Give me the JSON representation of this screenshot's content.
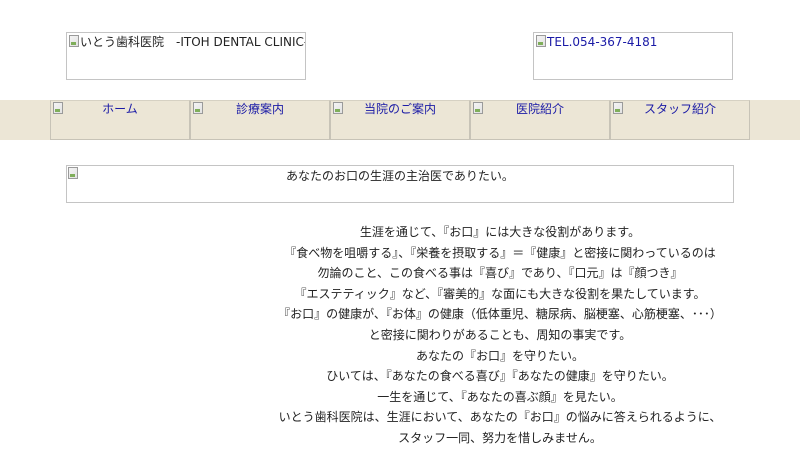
{
  "header": {
    "logo_alt": "いとう歯科医院　-ITOH DENTAL CLINIC-",
    "tel_alt": "TEL.054-367-4181"
  },
  "nav": {
    "items": [
      {
        "label": "ホーム"
      },
      {
        "label": "診療案内"
      },
      {
        "label": "当院のご案内"
      },
      {
        "label": "医院紹介"
      },
      {
        "label": "スタッフ紹介"
      }
    ]
  },
  "tagline": "あなたのお口の生涯の主治医でありたい。",
  "message": {
    "lines": [
      "生涯を通じて、『お口』には大きな役割があります。",
      "『食べ物を咀嚼する』、『栄養を摂取する』＝『健康』と密接に関わっているのは",
      "勿論のこと、この食べる事は『喜び』であり、『口元』は『顔つき』",
      "『エステティック』など、『審美的』な面にも大きな役割を果たしています。",
      "『お口』の健康が、『お体』の健康（低体重児、糖尿病、脳梗塞、心筋梗塞、･･･）",
      "と密接に関わりがあることも、周知の事実です。",
      "あなたの『お口』を守りたい。",
      "ひいては、『あなたの食べる喜び』『あなたの健康』を守りたい。",
      "一生を通じて、『あなたの喜ぶ顔』を見たい。",
      "いとう歯科医院は、生涯において、あなたの『お口』の悩みに答えられるように、",
      "スタッフ一同、努力を惜しみません。"
    ]
  },
  "colors": {
    "nav_background": "#ece6d6",
    "link_text": "#1a1aa6",
    "body_text": "#222222"
  }
}
